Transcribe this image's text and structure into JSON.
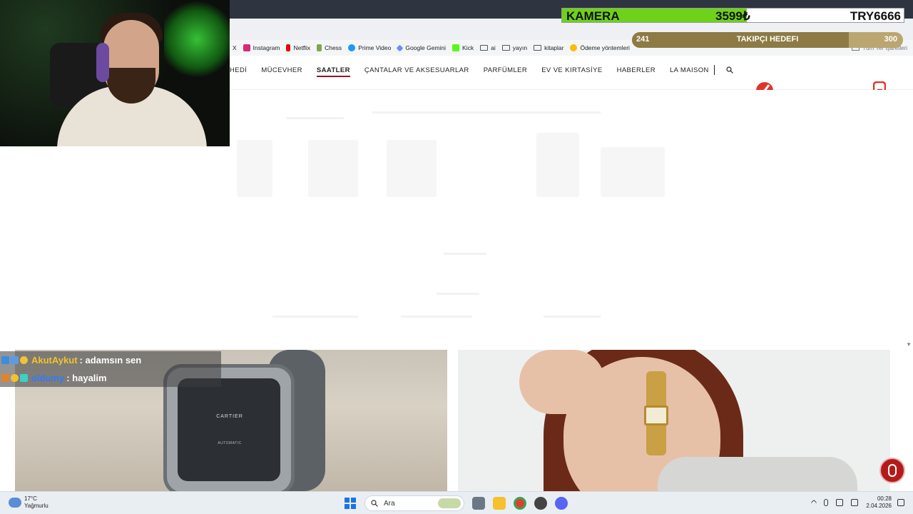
{
  "overlay": {
    "kamera_label": "KAMERA",
    "kamera_amount": "3599₺",
    "kamera_goal": "TRY6666",
    "kamera_progress": 0.54,
    "takipci_current": "241",
    "takipci_label": "TAKIPÇI HEDEFI",
    "takipci_goal": "300",
    "takipci_progress": 0.8
  },
  "bookmarks": {
    "x": "X",
    "items": [
      {
        "label": "Instagram",
        "icon": "instagram-icon",
        "color": "#d62976"
      },
      {
        "label": "Netflix",
        "icon": "netflix-icon",
        "color": "#e50914"
      },
      {
        "label": "Chess",
        "icon": "chess-icon",
        "color": "#7fa650"
      },
      {
        "label": "Prime Video",
        "icon": "prime-video-icon",
        "color": "#1a98ff"
      },
      {
        "label": "Google Gemini",
        "icon": "gemini-icon",
        "color": "#6b8cff"
      },
      {
        "label": "Kick",
        "icon": "kick-icon",
        "color": "#53fc18"
      },
      {
        "label": "ai",
        "icon": "folder-icon",
        "color": ""
      },
      {
        "label": "yayın",
        "icon": "folder-icon",
        "color": ""
      },
      {
        "label": "kitaplar",
        "icon": "folder-icon",
        "color": ""
      },
      {
        "label": "Ödeme yöntemleri",
        "icon": "google-ads-icon",
        "color": "#fbbc04"
      }
    ],
    "all_bookmarks": "Tüm Yer İşaretleri"
  },
  "nav": {
    "items": [
      "HEDİ",
      "MÜCEVHER",
      "SAATLER",
      "ÇANTALAR VE AKSESUARLAR",
      "PARFÜMLER",
      "EV VE KIRTASİYE",
      "HABERLER",
      "LA MAISON"
    ],
    "active": "SAATLER"
  },
  "hero": {
    "watch_brand": "CARTIER",
    "watch_sub": "AUTOMATIC"
  },
  "chat": [
    {
      "user": "AkutAykut",
      "message": ": adamsın sen",
      "color": "#f2c230"
    },
    {
      "user": "oldumy",
      "message": ": hayalim",
      "color": "#2e7bff"
    }
  ],
  "taskbar": {
    "temp": "17°C",
    "weather": "Yağmurlu",
    "search": "Ara",
    "time": "00:28",
    "date": "2.04.2026"
  }
}
